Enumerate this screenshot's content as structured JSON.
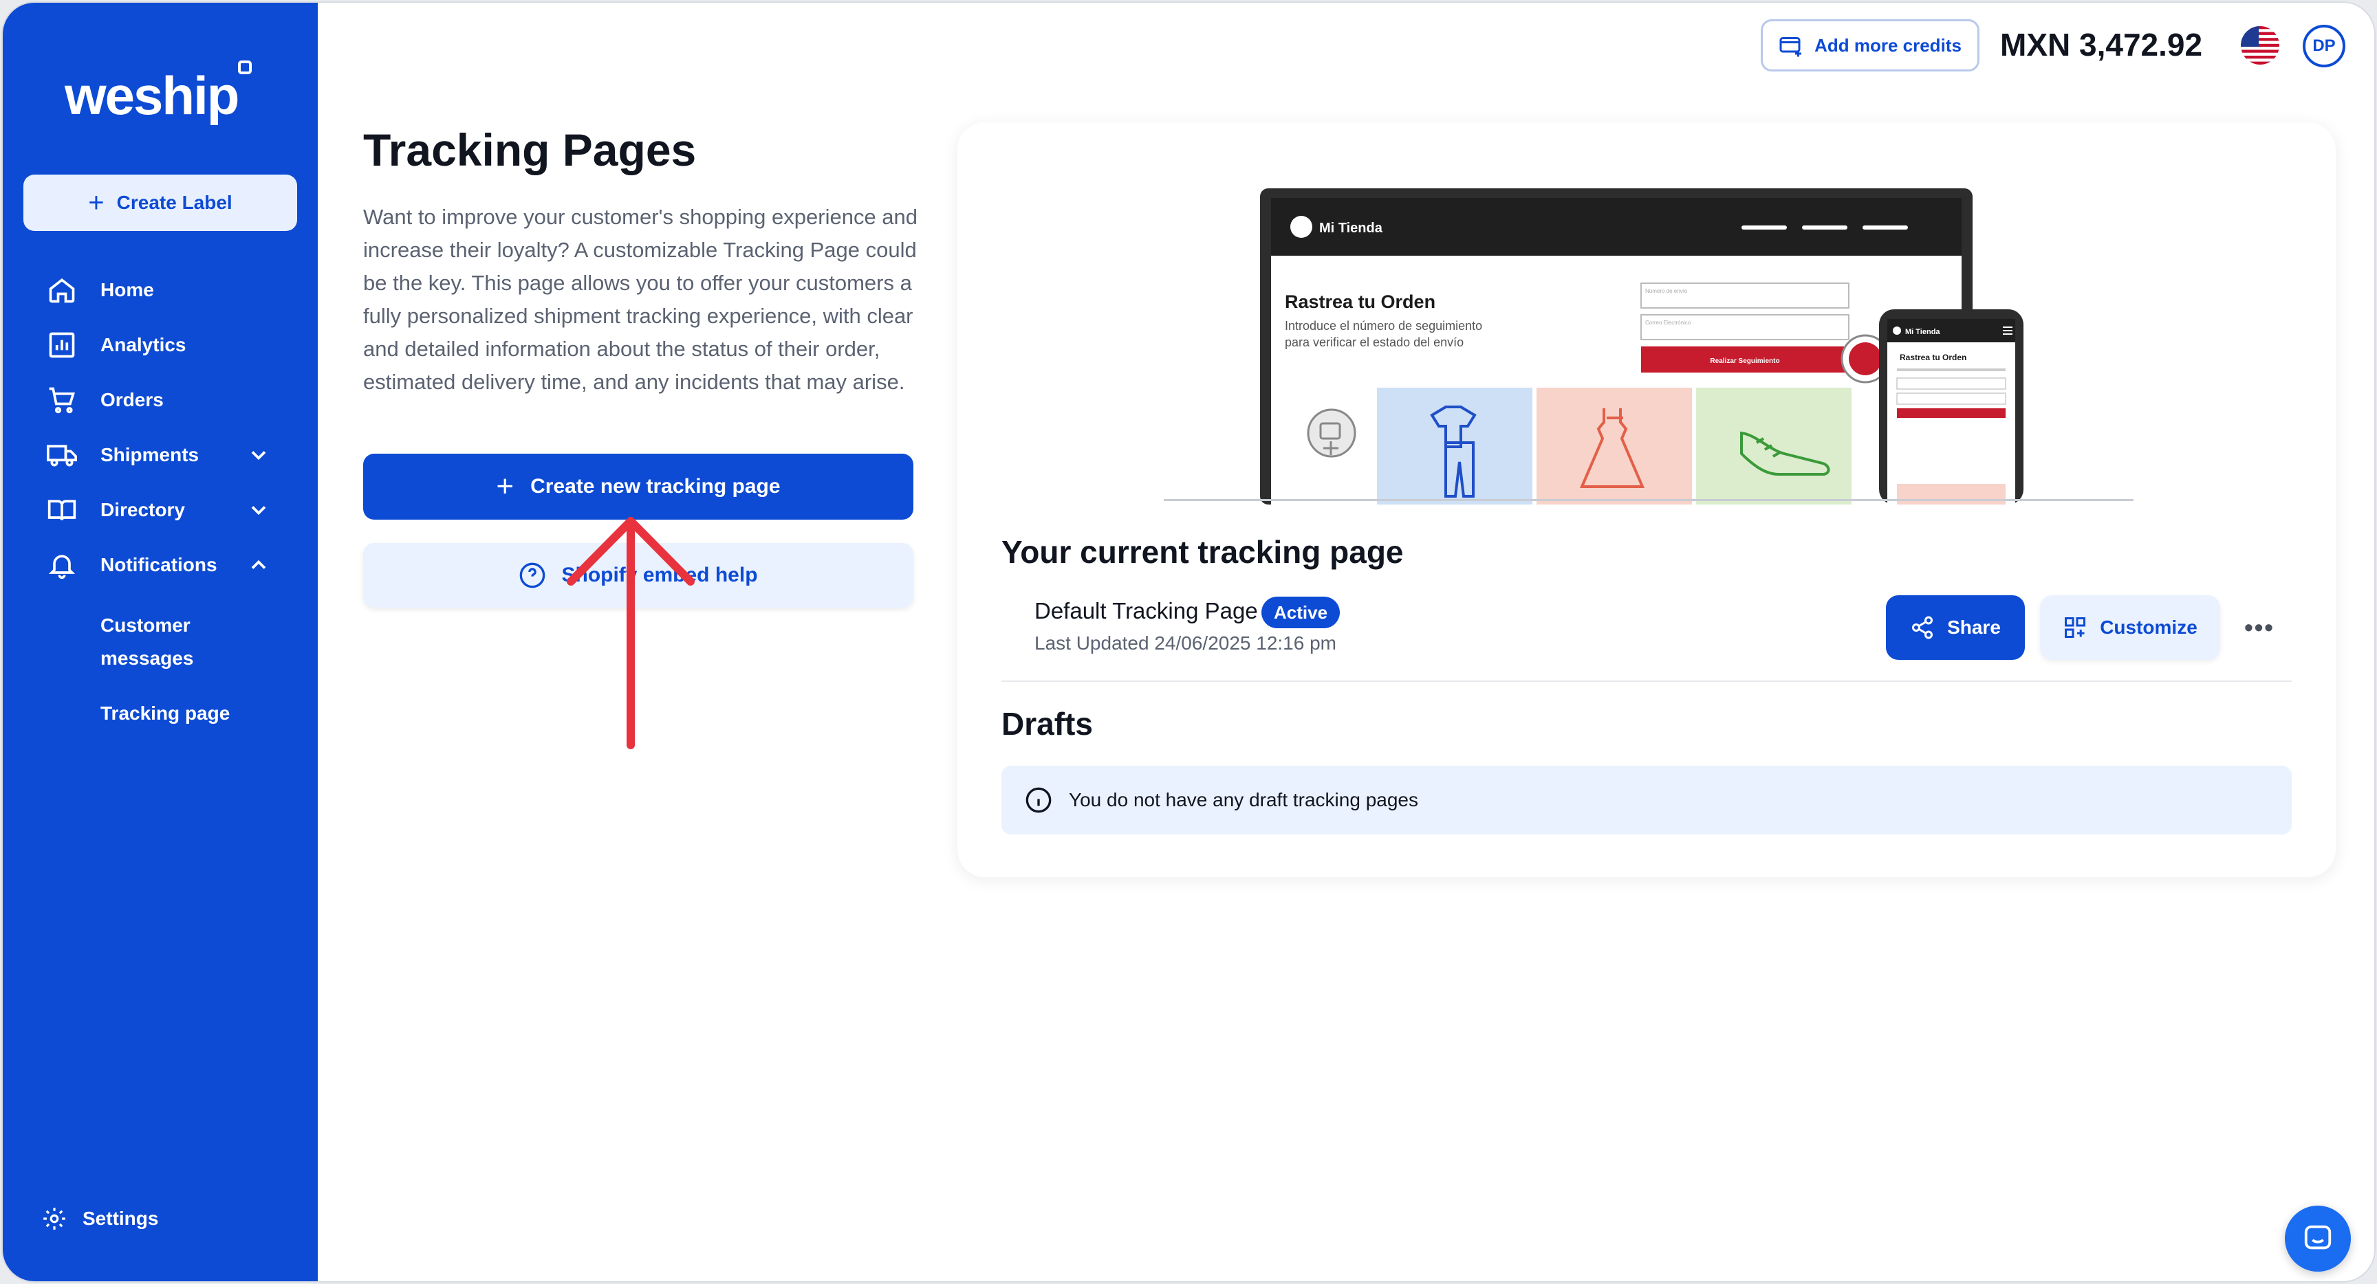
{
  "brand": {
    "logo": "weship",
    "accent": "#0d4bd4"
  },
  "sidebar": {
    "create_label": "Create Label",
    "items": [
      {
        "label": "Home",
        "icon": "home-icon"
      },
      {
        "label": "Analytics",
        "icon": "analytics-icon"
      },
      {
        "label": "Orders",
        "icon": "cart-icon"
      },
      {
        "label": "Shipments",
        "icon": "truck-icon",
        "expandable": true,
        "expanded": false
      },
      {
        "label": "Directory",
        "icon": "book-icon",
        "expandable": true,
        "expanded": false
      },
      {
        "label": "Notifications",
        "icon": "bell-icon",
        "expandable": true,
        "expanded": true
      }
    ],
    "sub_items": [
      "Customer messages",
      "Tracking page"
    ],
    "settings": "Settings"
  },
  "header": {
    "add_credits": "Add more credits",
    "balance": "MXN 3,472.92",
    "avatar_initials": "DP",
    "flag": "us-flag-icon"
  },
  "main": {
    "title": "Tracking Pages",
    "intro": "Want to improve your customer's shopping experience and increase their loyalty? A customizable Tracking Page could be the key. This page allows you to offer your customers a fully personalized shipment tracking experience, with clear and detailed information about the status of their order, estimated delivery time, and any incidents that may arise.",
    "create_button": "Create new tracking page",
    "help_button": "Shopify embed help"
  },
  "mockup": {
    "store_name": "Mi Tienda",
    "heading": "Rastrea tu Orden",
    "subtext_1": "Introduce el número de seguimiento",
    "subtext_2": "para verificar el estado del envío",
    "field_1": "Número de envío",
    "field_2": "Correo Electrónico",
    "button": "Realizar Seguimiento"
  },
  "card": {
    "current_title": "Your current tracking page",
    "page_name": "Default Tracking Page",
    "status": "Active",
    "last_updated": "Last Updated 24/06/2025 12:16 pm",
    "share": "Share",
    "customize": "Customize",
    "more": "•••",
    "drafts_title": "Drafts",
    "drafts_empty": "You do not have any draft tracking pages"
  }
}
